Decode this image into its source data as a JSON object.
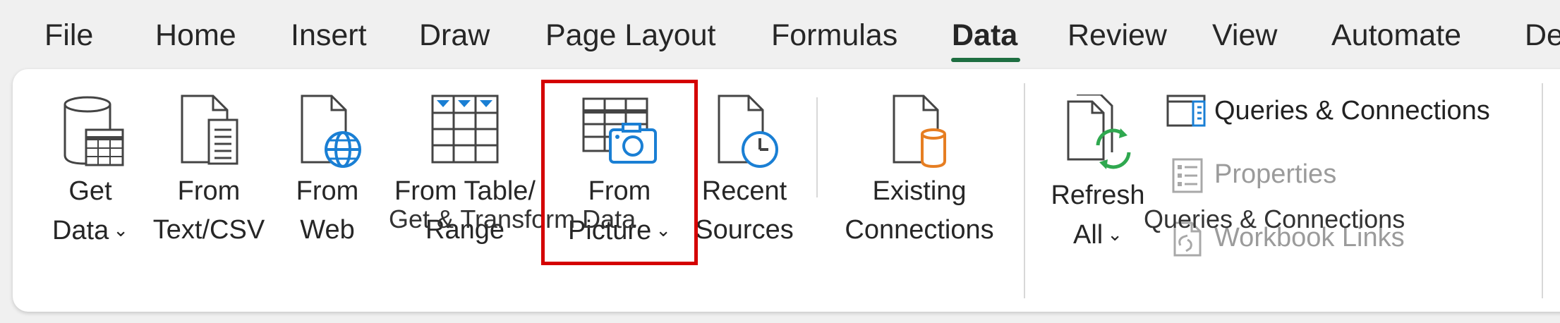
{
  "tabs": [
    {
      "label": "File",
      "active": false
    },
    {
      "label": "Home",
      "active": false
    },
    {
      "label": "Insert",
      "active": false
    },
    {
      "label": "Draw",
      "active": false
    },
    {
      "label": "Page Layout",
      "active": false
    },
    {
      "label": "Formulas",
      "active": false
    },
    {
      "label": "Data",
      "active": true
    },
    {
      "label": "Review",
      "active": false
    },
    {
      "label": "View",
      "active": false
    },
    {
      "label": "Automate",
      "active": false
    },
    {
      "label": "De",
      "active": false
    }
  ],
  "groups": {
    "get_transform": {
      "label": "Get & Transform Data",
      "commands": {
        "get_data": {
          "line1": "Get",
          "line2": "Data",
          "icon": "database-table-icon",
          "has_dropdown": true
        },
        "from_text_csv": {
          "line1": "From",
          "line2": "Text/CSV",
          "icon": "text-document-icon"
        },
        "from_web": {
          "line1": "From",
          "line2": "Web",
          "icon": "web-document-icon"
        },
        "from_table_range": {
          "line1": "From Table/",
          "line2": "Range",
          "icon": "table-range-icon"
        },
        "from_picture": {
          "line1": "From",
          "line2": "Picture",
          "icon": "camera-table-icon",
          "has_dropdown": true,
          "highlighted": true
        },
        "recent_sources": {
          "line1": "Recent",
          "line2": "Sources",
          "icon": "clock-document-icon"
        },
        "existing_connections": {
          "line1": "Existing",
          "line2": "Connections",
          "icon": "database-document-icon"
        }
      }
    },
    "queries_connections": {
      "label": "Queries & Connections",
      "commands": {
        "refresh_all": {
          "line1": "Refresh",
          "line2": "All",
          "icon": "refresh-icon",
          "has_dropdown": true
        },
        "queries_connections": {
          "label": "Queries & Connections",
          "icon": "queries-pane-icon",
          "enabled": true
        },
        "properties": {
          "label": "Properties",
          "icon": "properties-icon",
          "enabled": false
        },
        "workbook_links": {
          "label": "Workbook Links",
          "icon": "workbook-links-icon",
          "enabled": false
        }
      }
    }
  },
  "colors": {
    "active_tab_underline": "#1e6e41",
    "highlight_box": "#d40000",
    "icon_blue": "#1a7fd4",
    "icon_orange": "#e67e22",
    "icon_green": "#2fa84f",
    "disabled_text": "#9b9b9b"
  }
}
